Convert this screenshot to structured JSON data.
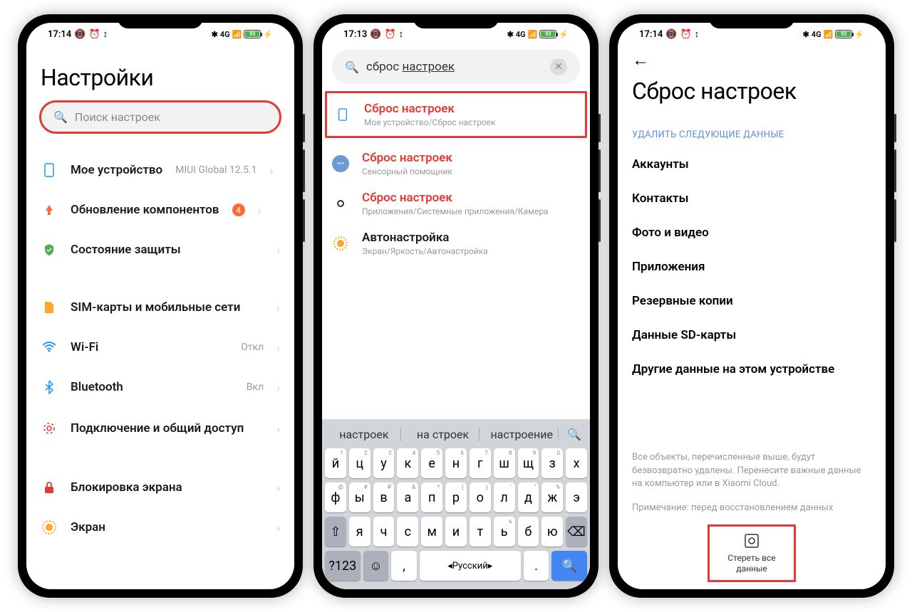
{
  "status": {
    "time1": "17:14",
    "time2": "17:13",
    "time3": "17:14",
    "battery": "93",
    "network": "4G"
  },
  "phone1": {
    "title": "Настройки",
    "search_placeholder": "Поиск настроек",
    "items": [
      {
        "icon": "phone",
        "label": "Мое устройство",
        "value": "MIUI Global 12.5.1"
      },
      {
        "icon": "update",
        "label": "Обновление компонентов",
        "badge": "4"
      },
      {
        "icon": "shield",
        "label": "Состояние защиты"
      },
      {
        "icon": "sim",
        "label": "SIM-карты и мобильные сети"
      },
      {
        "icon": "wifi",
        "label": "Wi-Fi",
        "value": "Откл"
      },
      {
        "icon": "bluetooth",
        "label": "Bluetooth",
        "value": "Вкл"
      },
      {
        "icon": "share",
        "label": "Подключение и общий доступ"
      },
      {
        "icon": "lock",
        "label": "Блокировка экрана"
      },
      {
        "icon": "brightness",
        "label": "Экран"
      }
    ]
  },
  "phone2": {
    "search_value": "сброс ",
    "search_underlined": "настроек",
    "results": [
      {
        "icon": "phone",
        "title": "Сброс настроек",
        "path": "Мое устройство/Сброс настроек"
      },
      {
        "icon": "dots",
        "title": "Сброс настроек",
        "path": "Сенсорный помощник"
      },
      {
        "icon": "camera",
        "title": "Сброс настроек",
        "path": "Приложения/Системные приложения/Камера"
      },
      {
        "icon": "brightness",
        "title": "Автонастройка",
        "path": "Экран/Яркость/Автонастройка"
      }
    ],
    "suggestions": [
      "настроек",
      "на строек",
      "настроение"
    ],
    "keyboard": {
      "row1": [
        "й",
        "ц",
        "у",
        "к",
        "е",
        "н",
        "г",
        "ш",
        "щ",
        "з",
        "х"
      ],
      "row1_hints": [
        "1",
        "2",
        "3",
        "4",
        "5",
        "6",
        "7",
        "8",
        "9",
        "0",
        ""
      ],
      "row2": [
        "ф",
        "ы",
        "в",
        "а",
        "п",
        "р",
        "о",
        "л",
        "д",
        "ж",
        "э"
      ],
      "row2_hints": [
        "@",
        "#",
        "₽",
        "&",
        "*",
        "(",
        ")",
        "'",
        "\"",
        "%",
        ""
      ],
      "row3": [
        "я",
        "ч",
        "с",
        "м",
        "и",
        "т",
        "ь",
        "б",
        "ю"
      ],
      "row3_hints": [
        "",
        "",
        "",
        "",
        "",
        "",
        "ъ",
        "",
        ""
      ],
      "lang": "Русский",
      "num_key": "?123"
    }
  },
  "phone3": {
    "title": "Сброс настроек",
    "section": "УДАЛИТЬ СЛЕДУЮЩИЕ ДАННЫЕ",
    "items": [
      "Аккаунты",
      "Контакты",
      "Фото и видео",
      "Приложения",
      "Резервные копии",
      "Данные SD-карты",
      "Другие данные на этом устройстве"
    ],
    "footer1": "Все объекты, перечисленные выше, будут безвозвратно удалены. Перенесите важные данные на компьютер или в Xiaomi Cloud.",
    "footer2": "Примечание: перед восстановлением данных",
    "erase_label": "Стереть все данные"
  }
}
